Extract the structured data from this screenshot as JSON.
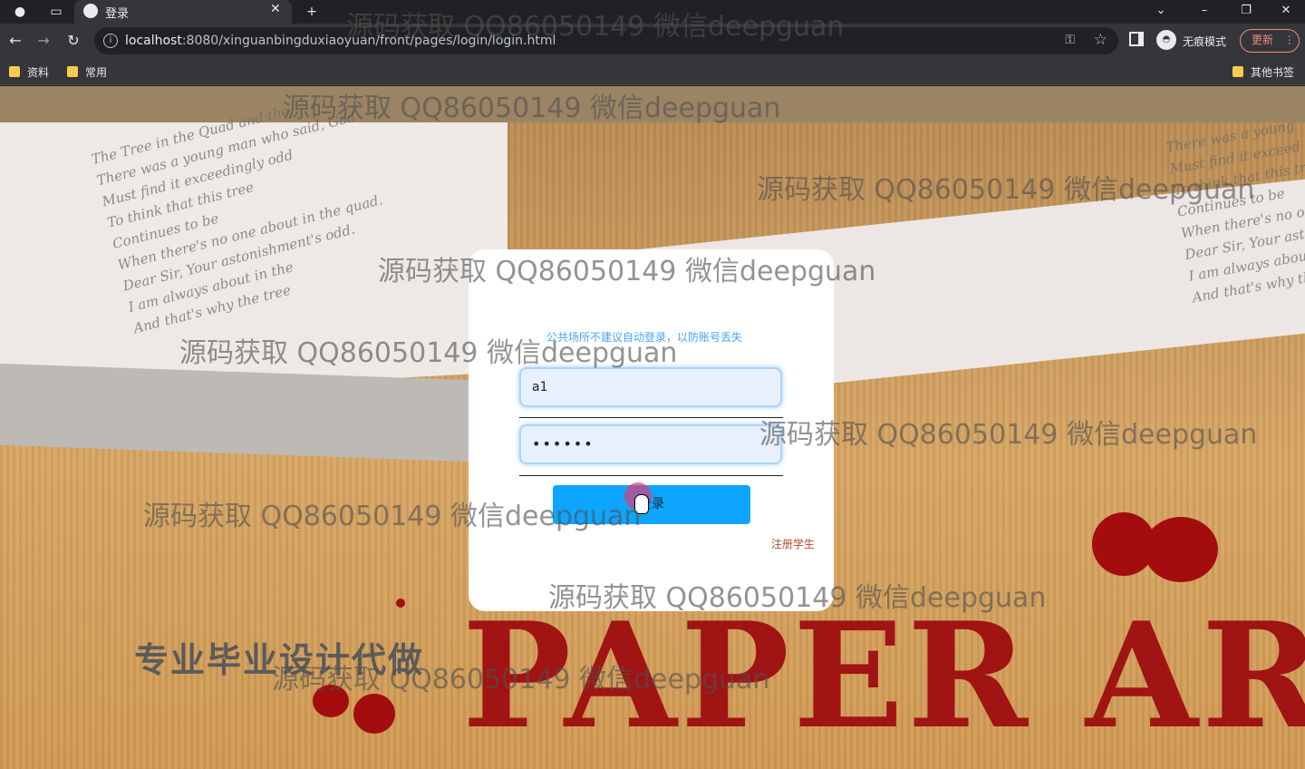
{
  "browser": {
    "tab_title": "登录",
    "url_host": "localhost",
    "url_rest": ":8080/xinguanbingduxiaoyuan/front/pages/login/login.html",
    "profile_label": "无痕模式",
    "update_label": "更新",
    "bookmarks": [
      "资料",
      "常用"
    ],
    "other_bookmarks": "其他书签"
  },
  "login": {
    "tip": "公共场所不建议自动登录，以防账号丢失",
    "username_value": "a1",
    "password_value": "••••••",
    "login_label": "登录",
    "register_label": "注册学生"
  },
  "background": {
    "big_title": "PAPER ART",
    "promo_text": "专业毕业设计代做",
    "script_lines_left": "The Tree in the Quad and the\nThere was a young man who said, God\nMust find it exceedingly odd\nTo think that this tree\nContinues to be\nWhen there's no one about in the quad.\nDear Sir, Your astonishment's odd.\nI am always about in the\nAnd that's why the tree",
    "script_lines_right": "There was a young\nMust find it exceed\nTo think that this tr\nContinues to be\nWhen there's no one\nDear Sir, Your astoni\nI am always about in\nAnd that's why the tre"
  },
  "watermark": "源码获取 QQ86050149 微信deepguan",
  "colors": {
    "login_button": "#0ea5ff",
    "tip_text": "#46a3ff",
    "register_text": "#b44c2a",
    "paper_art_red": "#a01414"
  }
}
